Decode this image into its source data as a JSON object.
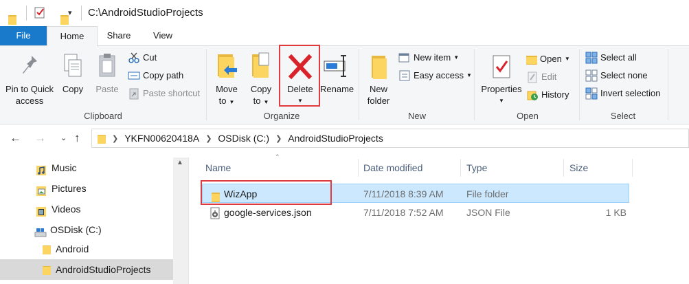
{
  "window": {
    "path_title": "C:\\AndroidStudioProjects",
    "qat_dropdown": "▾"
  },
  "tabs": [
    {
      "label": "File"
    },
    {
      "label": "Home"
    },
    {
      "label": "Share"
    },
    {
      "label": "View"
    }
  ],
  "ribbon": {
    "clipboard": {
      "group_label": "Clipboard",
      "pin_line1": "Pin to Quick",
      "pin_line2": "access",
      "copy": "Copy",
      "paste": "Paste",
      "cut": "Cut",
      "copy_path": "Copy path",
      "paste_shortcut": "Paste shortcut"
    },
    "organize": {
      "group_label": "Organize",
      "move_to_line1": "Move",
      "move_to_line2": "to",
      "copy_to_line1": "Copy",
      "copy_to_line2": "to",
      "delete": "Delete",
      "rename": "Rename"
    },
    "new": {
      "group_label": "New",
      "new_folder_line1": "New",
      "new_folder_line2": "folder",
      "new_item": "New item",
      "easy_access": "Easy access"
    },
    "open": {
      "group_label": "Open",
      "properties": "Properties",
      "open": "Open",
      "edit": "Edit",
      "history": "History"
    },
    "select": {
      "group_label": "Select",
      "select_all": "Select all",
      "select_none": "Select none",
      "invert_selection": "Invert selection"
    }
  },
  "address": {
    "crumbs": [
      "YKFN00620418A",
      "OSDisk (C:)",
      "AndroidStudioProjects"
    ]
  },
  "nav_pane": {
    "items": [
      {
        "label": "Music",
        "icon": "music-icon"
      },
      {
        "label": "Pictures",
        "icon": "pictures-icon"
      },
      {
        "label": "Videos",
        "icon": "videos-icon"
      },
      {
        "label": "OSDisk (C:)",
        "icon": "drive-icon"
      },
      {
        "label": "Android",
        "icon": "folder-icon"
      },
      {
        "label": "AndroidStudioProjects",
        "icon": "folder-icon",
        "selected": true
      }
    ]
  },
  "file_list": {
    "columns": [
      "Name",
      "Date modified",
      "Type",
      "Size"
    ],
    "rows": [
      {
        "name": "WizApp",
        "date": "7/11/2018 8:39 AM",
        "type": "File folder",
        "size": "",
        "icon": "folder-icon",
        "selected": true
      },
      {
        "name": "google-services.json",
        "date": "7/11/2018 7:52 AM",
        "type": "JSON File",
        "size": "1 KB",
        "icon": "json-file-icon",
        "selected": false
      }
    ]
  },
  "colors": {
    "file_tab": "#1979ca",
    "highlight": "#e0393e",
    "selection": "#cce8ff",
    "delete_x": "#d9232b",
    "folder": "#fbd55f"
  }
}
